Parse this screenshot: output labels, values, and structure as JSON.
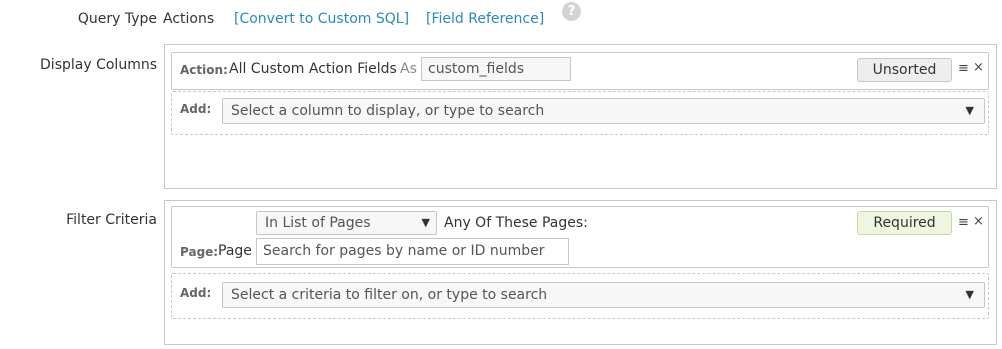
{
  "query_type": {
    "label": "Query Type",
    "value": "Actions",
    "convert_link": "[Convert to Custom SQL]",
    "field_ref_link": "[Field Reference]",
    "help_glyph": "?"
  },
  "display_columns": {
    "label": "Display Columns",
    "column_row": {
      "type_label": "Action:",
      "field_text": "All Custom Action Fields",
      "as_text": "As",
      "alias_value": "custom_fields",
      "sort_label": "Unsorted",
      "menu_glyph": "≡",
      "remove_glyph": "×"
    },
    "add_row": {
      "add_label": "Add:",
      "placeholder": "Select a column to display, or type to search",
      "arrow_glyph": "▼"
    }
  },
  "filter_criteria": {
    "label": "Filter Criteria",
    "filter_row": {
      "operator_value": "In List of Pages",
      "operator_arrow": "▼",
      "operator_suffix": "Any Of These Pages:",
      "required_label": "Required",
      "menu_glyph": "≡",
      "remove_glyph": "×",
      "type_label": "Page:",
      "field_text": "Page",
      "search_placeholder": "Search for pages by name or ID number"
    },
    "add_row": {
      "add_label": "Add:",
      "placeholder": "Select a criteria to filter on, or type to search",
      "arrow_glyph": "▼"
    }
  }
}
